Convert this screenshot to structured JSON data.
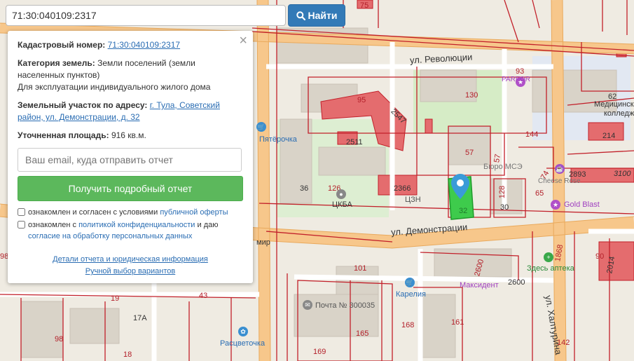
{
  "search": {
    "value": "71:30:040109:2317",
    "button_label": "Найти"
  },
  "panel": {
    "cadastral_label": "Кадастровый номер:",
    "cadastral_value": "71:30:040109:2317",
    "category_label": "Категория земель:",
    "category_value": "Земли поселений (земли населенных пунктов)",
    "usage": "Для эксплуатации индивидуального жилого дома",
    "address_label": "Земельный участок по адресу:",
    "address_value": "г. Тула, Советский район, ул. Демонстрации, д. 32",
    "area_label": "Уточненная площадь:",
    "area_value": "916 кв.м.",
    "email_placeholder": "Ваш email, куда отправить отчет",
    "report_button": "Получить подробный отчет",
    "consent1_prefix": "ознакомлен и согласен с условиями ",
    "consent1_link": "публичной оферты",
    "consent2_prefix": "ознакомлен с ",
    "consent2_link1": "политикой конфиденциальности",
    "consent2_mid": " и даю ",
    "consent2_link2": "согласие на обработку персональных данных",
    "details_link": "Детали отчета и юридическая информация",
    "manual_link": "Ручной выбор вариантов"
  },
  "map": {
    "streets": {
      "revolution": "ул. Революции",
      "demonstration": "ул. Демонстрации",
      "khaturina": "ул. Халтурина",
      "mir": "мир"
    },
    "pois": {
      "pyaterochka": "Пятёрочка",
      "ckba": "ЦКБА",
      "czn": "ЦЗН",
      "parfor": "PARFOR",
      "medical_college_1": "Медицинск",
      "medical_college_2": "колледж",
      "buro_mse": "Бюро МСЭ",
      "cheese_rose": "Cheese Rose",
      "gold_blast": "Gold Blast",
      "zdes_apteka": "Здесь аптека",
      "maksident": "Максидент",
      "karelia": "Карелия",
      "pochta": "Почта № 300035",
      "rascvetochka": "Расцветочка"
    },
    "numbers": {
      "n75": "75",
      "n93": "93",
      "n130": "130",
      "n62": "62",
      "n95": "95",
      "n2547": "2547",
      "n144": "144",
      "n214": "214",
      "n2511": "2511",
      "n57": "57",
      "n57b": "57",
      "n74": "74",
      "n2893": "2893",
      "n3100": "3100",
      "n36": "36",
      "n126": "126",
      "n2366": "2366",
      "n128": "128",
      "n65": "65",
      "n30": "30",
      "n32": "32",
      "n1868": "1868",
      "n90": "90",
      "n2014": "2014",
      "n101": "101",
      "n2600": "2600",
      "n2600b": "2600",
      "n19": "19",
      "n43": "43",
      "n17a": "17А",
      "n98": "98",
      "n165": "165",
      "n168": "168",
      "n161": "161",
      "n169": "169",
      "n142": "142",
      "n18": "18",
      "n98b": "98"
    }
  },
  "colors": {
    "road_major": "#f7c78b",
    "road_minor": "#ffffff",
    "building": "#ddd7cc",
    "building_red": "#e0686b",
    "park": "#d6ecc6",
    "cadastre_line": "#c2202a",
    "highlight_plot": "#3ecb4c",
    "pin": "#3a9bd8"
  }
}
